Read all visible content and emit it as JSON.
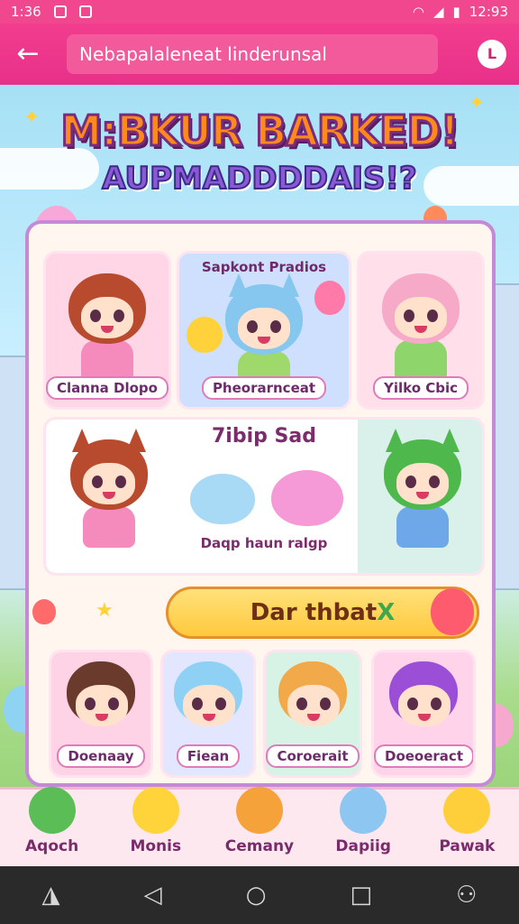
{
  "statusbar": {
    "time_left": "1:36",
    "time_right": "12:93"
  },
  "appbar": {
    "url": "Nebapalaleneat linderunsal",
    "avatar_letter": "L"
  },
  "title": {
    "line1": "M:BKUR BARKED!",
    "line2": "AUPMADDDDAIS!?"
  },
  "cards_top": [
    {
      "label": "Clanna Dlopo",
      "hair": "#b84a2e",
      "bg": "#ffd6e6",
      "outfit": "#f58bbd"
    },
    {
      "label": "Pheorarnceat",
      "title": "Sapkont Pradios",
      "hair": "#86c7ef",
      "bg": "#cfe0ff",
      "outfit": "#9fd86b"
    },
    {
      "label": "Yilko Cbic",
      "hair": "#f7a9c8",
      "bg": "#ffe0ea",
      "outfit": "#8ed56c"
    }
  ],
  "card_middle": {
    "title": "7ibip Sad",
    "caption": "Daqp haun ralgp",
    "hair_left": "#b84a2e",
    "hair_right": "#4fb84c"
  },
  "action_button": {
    "label": "Dar thbat",
    "mark": "X"
  },
  "cards_bottom": [
    {
      "label": "Doenaay",
      "hair": "#6a3a2c",
      "bg": "#ffd3e6"
    },
    {
      "label": "Fiean",
      "hair": "#8fd0f5",
      "bg": "#e2e6ff"
    },
    {
      "label": "Coroerait",
      "hair": "#f2a94a",
      "bg": "#d7f3e5"
    },
    {
      "label": "Doeoeract",
      "hair": "#9b4fd6",
      "bg": "#ffd3ea"
    }
  ],
  "bottom_nav": [
    {
      "label": "Aqoch",
      "color": "#5bbd56"
    },
    {
      "label": "Monis",
      "color": "#ffd43b"
    },
    {
      "label": "Cemany",
      "color": "#f5a23a"
    },
    {
      "label": "Dapiig",
      "color": "#8dc6f0"
    },
    {
      "label": "Pawak",
      "color": "#ffcf3b"
    }
  ],
  "system_nav": {
    "left": "◮",
    "back": "◁",
    "home": "○",
    "recents": "□",
    "person": "⚇"
  }
}
